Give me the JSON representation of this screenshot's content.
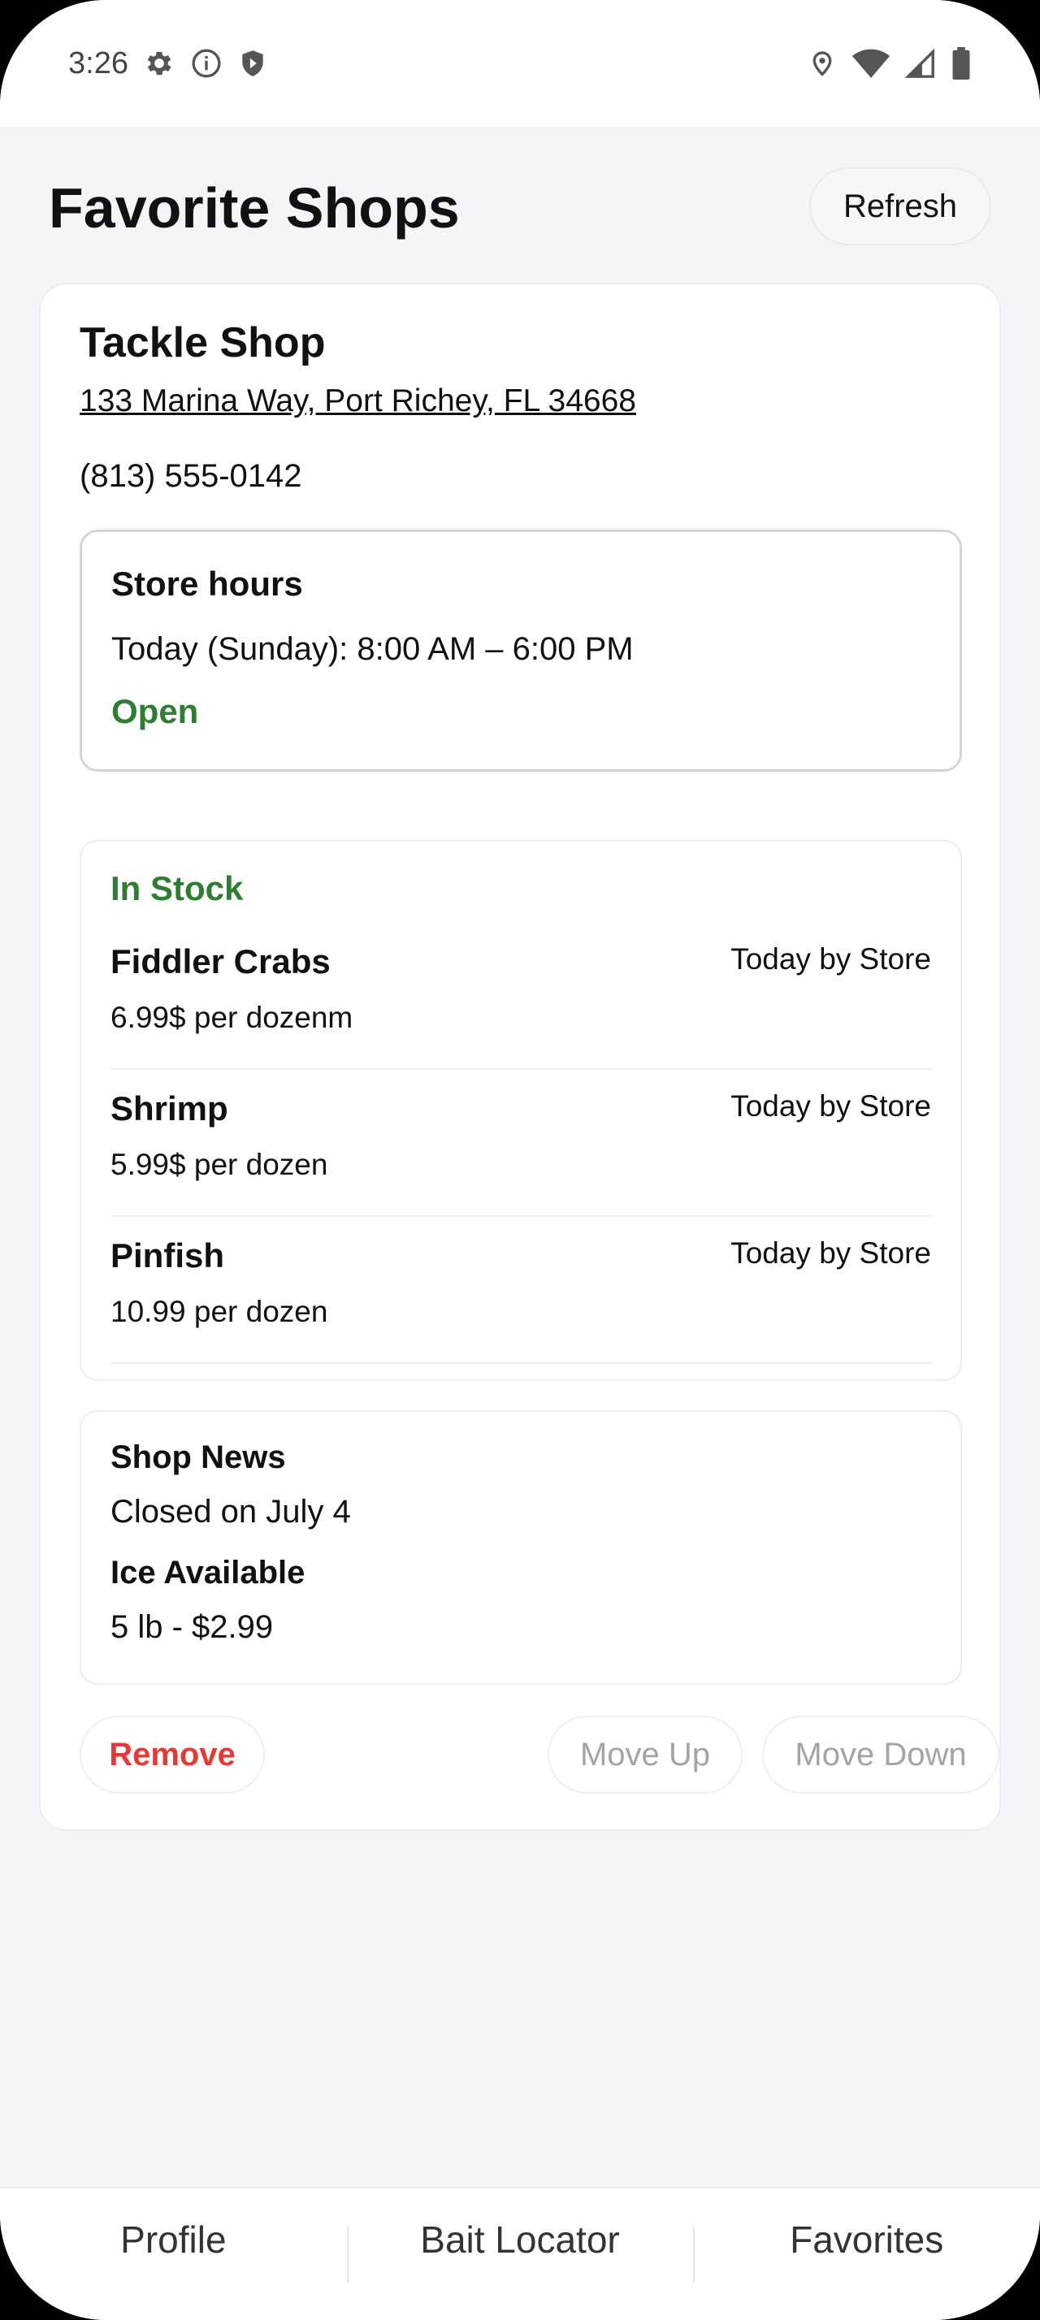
{
  "status_bar": {
    "time": "3:26",
    "left_icons": [
      "gear-icon",
      "info-icon",
      "shield-icon"
    ],
    "right_icons": [
      "location-pin-icon",
      "wifi-icon",
      "cell-signal-icon",
      "battery-icon"
    ]
  },
  "header": {
    "title": "Favorite Shops",
    "refresh_label": "Refresh"
  },
  "shop": {
    "name": "Tackle Shop",
    "address": "133 Marina Way, Port Richey, FL 34668",
    "phone": "(813) 555-0142",
    "hours": {
      "title": "Store hours",
      "today": "Today (Sunday): 8:00 AM – 6:00 PM",
      "status": "Open"
    },
    "stock": {
      "title": "In Stock",
      "items": [
        {
          "name": "Fiddler Crabs",
          "price": "6.99$ per dozenm",
          "source": "Today by Store"
        },
        {
          "name": "Shrimp",
          "price": "5.99$ per dozen",
          "source": "Today by Store"
        },
        {
          "name": "Pinfish",
          "price": "10.99 per dozen",
          "source": "Today by Store"
        }
      ]
    },
    "news": {
      "heading": "Shop News",
      "text": "Closed on July 4",
      "ice_heading": "Ice Available",
      "ice_text": "5 lb - $2.99"
    },
    "actions": {
      "remove": "Remove",
      "move_up": "Move Up",
      "move_down": "Move Down"
    }
  },
  "bottom_nav": {
    "items": [
      "Profile",
      "Bait Locator",
      "Favorites"
    ]
  },
  "colors": {
    "accent_green": "#2e7d32",
    "remove_red": "#e53935",
    "disabled_gray": "#a2a4a8",
    "background": "#f4f5f9"
  }
}
